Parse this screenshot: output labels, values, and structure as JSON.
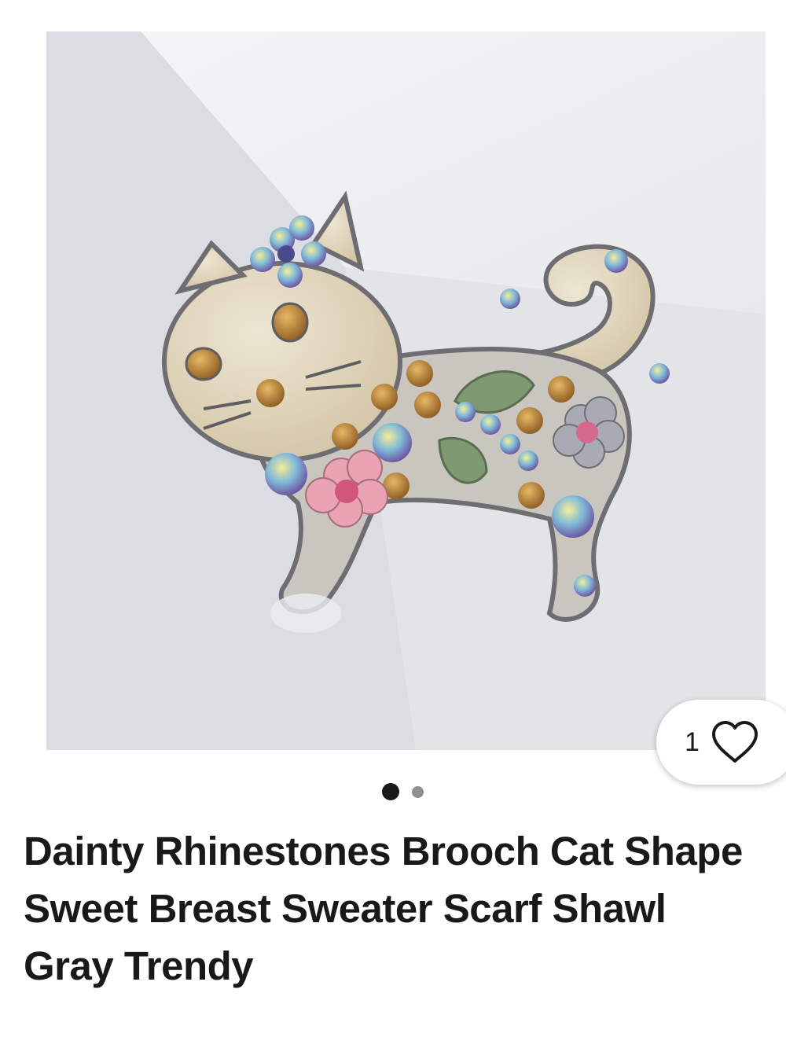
{
  "listing": {
    "title": "Dainty Rhinestones Brooch Cat Shape Sweet Breast Sweater Scarf Shawl Gray Trendy",
    "like_count": "1",
    "image_count": 2,
    "active_image_index": 0
  },
  "icons": {
    "like": "heart-outline-icon"
  },
  "colors": {
    "text": "#191919",
    "background": "#ffffff",
    "dot_active": "#191919",
    "dot_inactive": "#8f8f8f"
  }
}
